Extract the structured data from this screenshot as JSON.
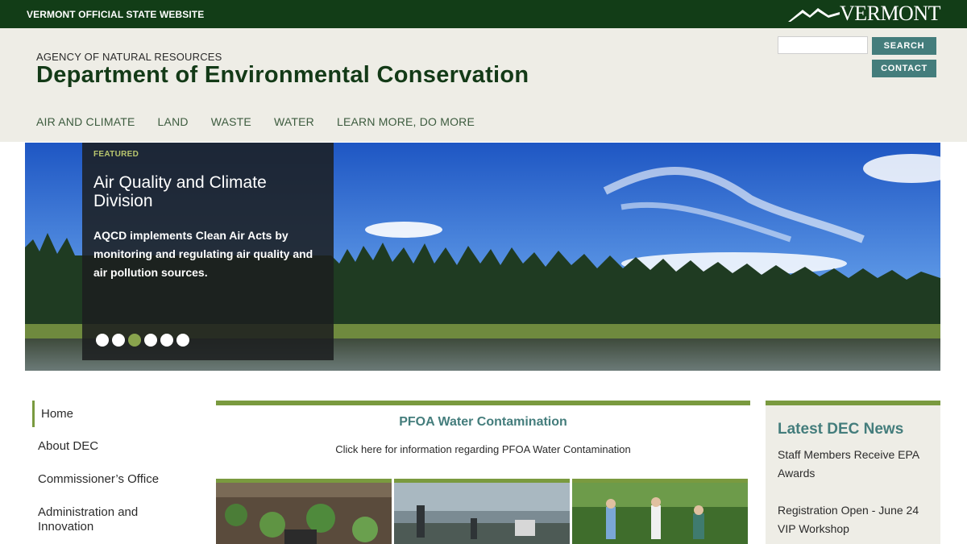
{
  "topbar": {
    "site_label": "VERMONT OFFICIAL STATE WEBSITE",
    "logo_text": "VERMONT"
  },
  "header": {
    "agency": "AGENCY OF NATURAL RESOURCES",
    "department": "Department of Environmental Conservation",
    "search_placeholder": "",
    "search_button": "SEARCH",
    "contact_button": "CONTACT"
  },
  "nav": {
    "items": [
      "AIR AND CLIMATE",
      "LAND",
      "WASTE",
      "WATER",
      "LEARN MORE, DO MORE"
    ]
  },
  "hero": {
    "tag": "FEATURED",
    "title": "Air Quality and Climate Division",
    "description": "AQCD implements Clean Air Acts by monitoring and regulating air quality and air pollution sources.",
    "slides_count": 6,
    "active_slide": 3
  },
  "leftnav": {
    "items": [
      "Home",
      "About DEC",
      "Commissioner’s Office",
      "Administration and Innovation"
    ]
  },
  "feature": {
    "title": "PFOA Water Contamination",
    "text": "Click here for information regarding PFOA Water Contamination"
  },
  "news": {
    "title": "Latest DEC News",
    "items": [
      "Staff Members Receive EPA Awards",
      "Registration Open - June 24 VIP Workshop"
    ]
  },
  "colors": {
    "topbar": "#123d17",
    "header_bg": "#eeede6",
    "accent_green": "#7a9a3f",
    "teal": "#447d7c",
    "dark_title": "#133a17"
  },
  "icons": {
    "logo": "mountain-logo-icon"
  }
}
